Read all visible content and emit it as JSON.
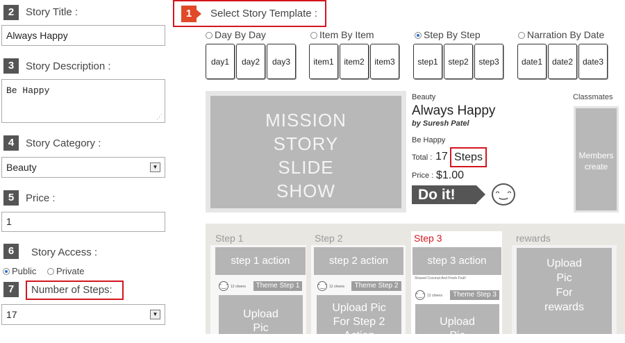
{
  "left": {
    "title": {
      "num": "2",
      "label": "Story Title :",
      "value": "Always Happy"
    },
    "description": {
      "num": "3",
      "label": "Story Description :",
      "value": "Be Happy"
    },
    "category": {
      "num": "4",
      "label": "Story Category :",
      "value": "Beauty"
    },
    "price": {
      "num": "5",
      "label": "Price :",
      "value": "1"
    },
    "access": {
      "num": "6",
      "label": "Story Access :",
      "options": [
        "Public",
        "Private"
      ],
      "selected": "Public"
    },
    "steps": {
      "num": "7",
      "label": "Number of Steps:",
      "value": "17"
    }
  },
  "template": {
    "num": "1",
    "label": "Select Story Template :",
    "groups": [
      {
        "label": "Day By Day",
        "selected": false,
        "cards": [
          "day1",
          "day2",
          "day3"
        ]
      },
      {
        "label": "Item By Item",
        "selected": false,
        "cards": [
          "item1",
          "item2",
          "item3"
        ]
      },
      {
        "label": "Step By Step",
        "selected": true,
        "cards": [
          "step1",
          "step2",
          "step3"
        ]
      },
      {
        "label": "Narration By Date",
        "selected": false,
        "cards": [
          "date1",
          "date2",
          "date3"
        ]
      }
    ]
  },
  "preview": {
    "slideshow_lines": [
      "MISSION",
      "STORY",
      "SLIDE",
      "SHOW"
    ],
    "category": "Beauty",
    "title": "Always Happy",
    "author": "by Suresh Patel",
    "description": "Be Happy",
    "total_label": "Total :",
    "total_value": "17",
    "total_unit": "Steps",
    "price_label": "Price :",
    "price_value": "$1.00",
    "do_it": "Do it!",
    "classmates_label": "Classmates",
    "members_text": "Members create"
  },
  "steps_panel": {
    "columns": [
      {
        "header": "Step 1",
        "action": "step 1 action",
        "theme": "Theme Step 1",
        "cheers": "12 cheers",
        "upload": [
          "Upload",
          "Pic"
        ]
      },
      {
        "header": "Step 2",
        "action": "step 2 action",
        "theme": "Theme Step 2",
        "cheers": "12 cheers",
        "upload": [
          "Upload Pic",
          "For Step 2",
          "Action"
        ]
      },
      {
        "header": "Step 3",
        "action": "step 3 action",
        "theme": "Theme Step 3",
        "cheers": "12 cheers",
        "caption": "Shaved Coconut And Fresh Fruit!",
        "upload": [
          "Upload",
          "Pic"
        ]
      }
    ],
    "rewards": {
      "header": "rewards",
      "upload": [
        "Upload",
        "Pic",
        "For",
        "rewards"
      ]
    }
  },
  "colors": {
    "highlight": "#d3161e",
    "badge": "#555555",
    "tile": "#b5b5b5"
  }
}
